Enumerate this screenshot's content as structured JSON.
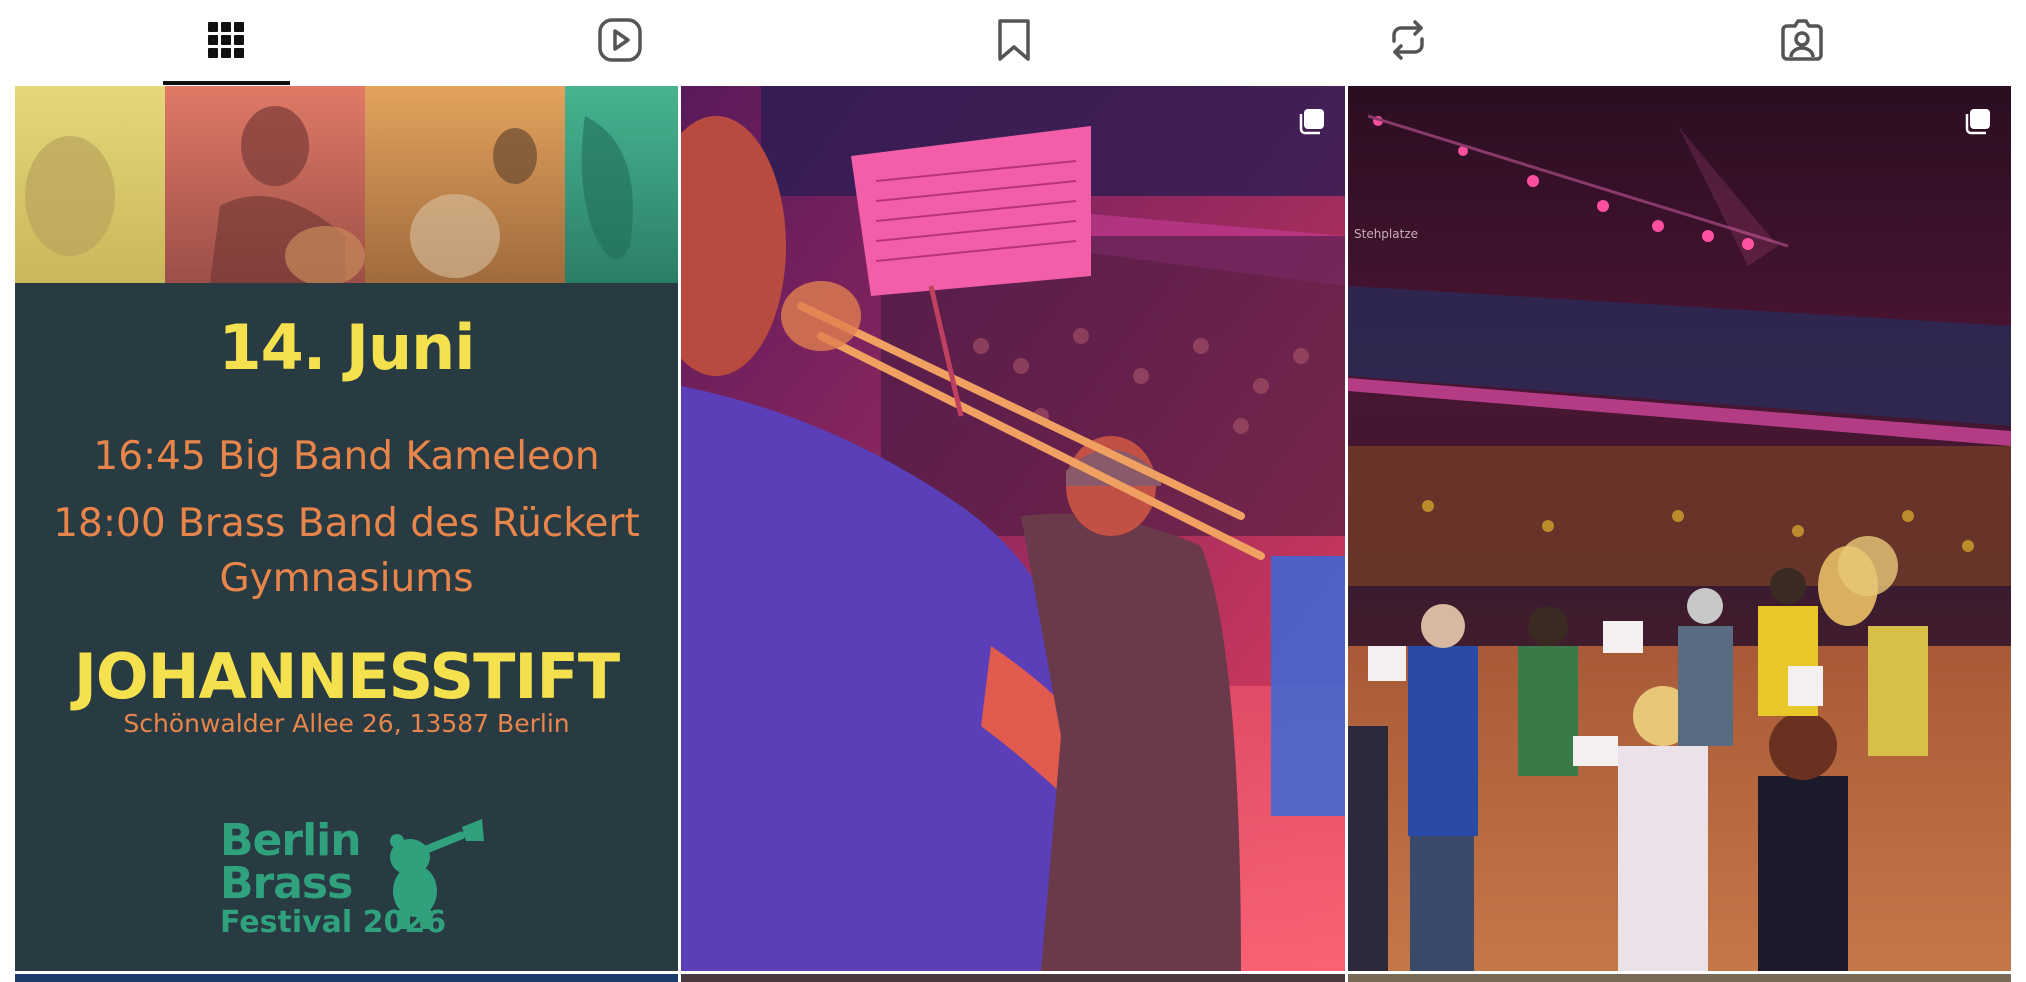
{
  "tabs": [
    {
      "name": "posts",
      "icon": "grid-icon",
      "active": true
    },
    {
      "name": "reels",
      "icon": "play-square-icon",
      "active": false
    },
    {
      "name": "saved",
      "icon": "bookmark-icon",
      "active": false
    },
    {
      "name": "reposts",
      "icon": "repost-icon",
      "active": false
    },
    {
      "name": "tagged",
      "icon": "tagged-person-icon",
      "active": false
    }
  ],
  "posts": [
    {
      "type": "poster",
      "date": "14. Juni",
      "lines": [
        "16:45 Big Band Kameleon",
        "18:00 Brass Band des Rückert",
        "Gymnasiums"
      ],
      "venue": "JOHANNESSTIFT",
      "address": "Schönwalder Allee 26, 13587 Berlin",
      "logo": {
        "line1": "Berlin",
        "line2": "Brass",
        "line3": "Festival 2026"
      }
    },
    {
      "type": "photo",
      "icon": "multiple-posts-icon",
      "subject": "trombone player on stage in arena"
    },
    {
      "type": "photo",
      "icon": "multiple-posts-icon",
      "subject": "large brass ensemble rehearsing in arena",
      "sign_text": "Stehplatze"
    }
  ],
  "colors": {
    "poster_bg": "#283a42",
    "poster_yellow": "#f5e04e",
    "poster_orange": "#e8854a",
    "logo_green": "#2fa27d",
    "tab_active": "#111111",
    "tab_icon": "#555555"
  }
}
